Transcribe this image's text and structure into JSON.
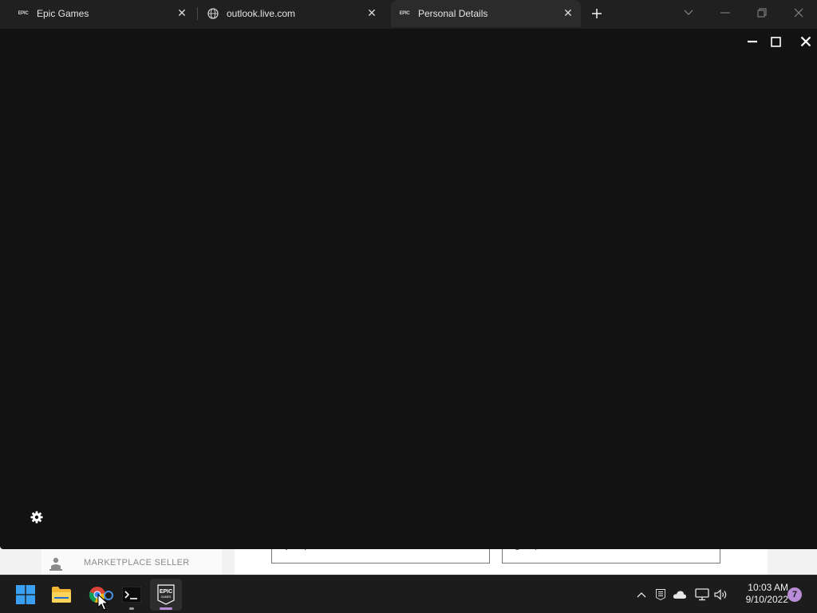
{
  "browser": {
    "tabs": [
      {
        "title": "Epic Games",
        "favicon": "epic-games-icon",
        "active": false
      },
      {
        "title": "outlook.live.com",
        "favicon": "globe-icon",
        "active": false
      },
      {
        "title": "Personal Details",
        "favicon": "epic-games-icon",
        "active": true
      }
    ],
    "favicon_text": "EPIC",
    "new_tab_icon": "plus-icon",
    "window_controls": [
      "chevron-down-icon",
      "minimize-icon",
      "restore-icon",
      "close-icon"
    ]
  },
  "launcher_overlay": {
    "background": "#121212",
    "controls": [
      "minimize-icon",
      "maximize-icon",
      "close-icon"
    ],
    "settings_icon": "gear-icon"
  },
  "underlying_page": {
    "sidebar_item": {
      "label": "MARKETPLACE SELLER",
      "icon": "seller-icon"
    },
    "fields": [
      {
        "partial_value": "V",
        "partial_value_2": "I"
      },
      {
        "partial_value": "U",
        "partial_value_2": "I"
      }
    ]
  },
  "taskbar": {
    "apps": [
      {
        "name": "Start",
        "icon": "windows-start-icon",
        "active": false
      },
      {
        "name": "File Explorer",
        "icon": "folder-icon",
        "active": false
      },
      {
        "name": "Chrome",
        "icon": "chrome-icon",
        "active": false
      },
      {
        "name": "Terminal",
        "icon": "terminal-icon",
        "active": false,
        "label": ">_"
      },
      {
        "name": "Epic Games Launcher",
        "icon": "epic-games-icon",
        "active": true,
        "label": "EPIC",
        "sublabel": "GAMES"
      }
    ],
    "tray": [
      "chevron-up-icon",
      "epic-games-icon",
      "cloud-icon",
      "network-icon",
      "volume-icon"
    ],
    "time": "10:03 AM",
    "date": "9/10/2022",
    "notification_count": "7",
    "accent": "#b98cd8"
  }
}
